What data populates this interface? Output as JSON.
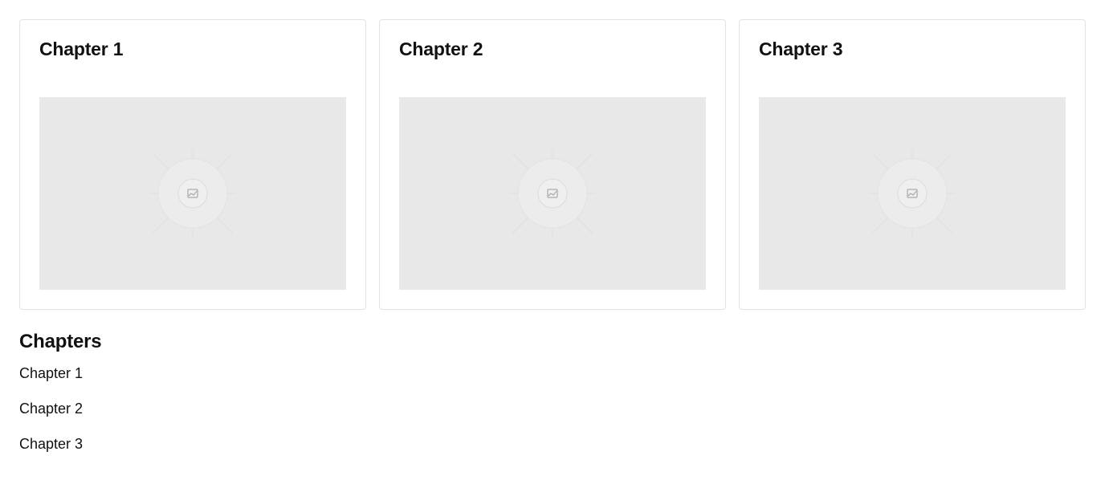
{
  "cards": [
    {
      "title": "Chapter 1",
      "image_icon": "image-placeholder-icon"
    },
    {
      "title": "Chapter 2",
      "image_icon": "image-placeholder-icon"
    },
    {
      "title": "Chapter 3",
      "image_icon": "image-placeholder-icon"
    }
  ],
  "chapters": {
    "heading": "Chapters",
    "items": [
      {
        "label": "Chapter 1"
      },
      {
        "label": "Chapter 2"
      },
      {
        "label": "Chapter 3"
      }
    ]
  },
  "colors": {
    "card_border": "#e3e3e3",
    "placeholder_bg": "#e8e8e8",
    "text": "#111111"
  }
}
